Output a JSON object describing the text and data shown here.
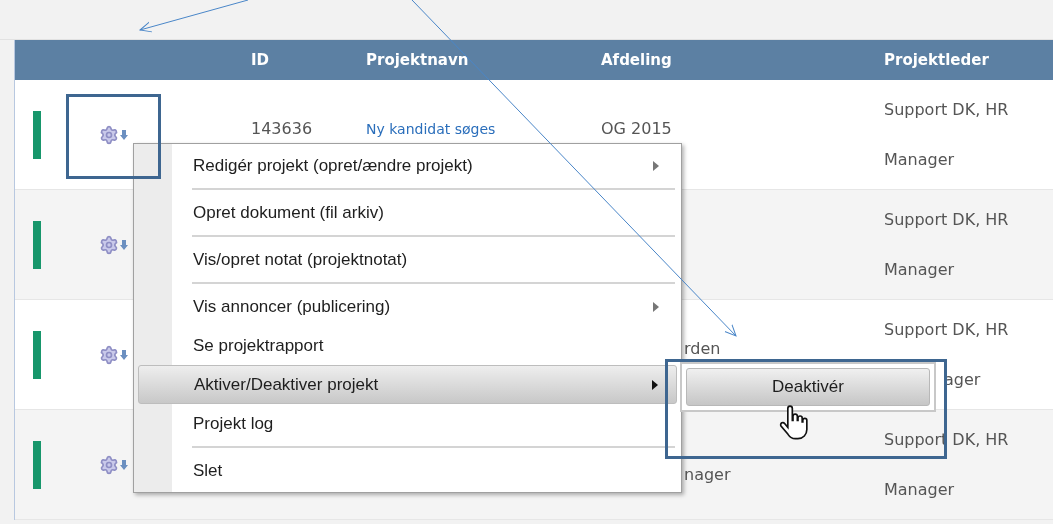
{
  "table": {
    "columns": [
      "ID",
      "Projektnavn",
      "Afdeling",
      "Projektleder"
    ],
    "rows": [
      {
        "color": "#17966b",
        "id": "143636",
        "name": "Ny kandidat søges",
        "department": "OG 2015",
        "manager": [
          "Support DK, HR",
          "Manager"
        ]
      },
      {
        "color": "#17966b",
        "manager": [
          "Support DK, HR",
          "Manager"
        ]
      },
      {
        "color": "#17966b",
        "department": "rden",
        "manager": [
          "Support DK, HR",
          "ager"
        ]
      },
      {
        "color": "#17966b",
        "department": "nager",
        "manager": [
          "Support DK, HR",
          "Manager"
        ]
      }
    ]
  },
  "context_menu": {
    "items": [
      {
        "label": "Redigér projekt (opret/ændre projekt)",
        "has_submenu": true,
        "selected": false,
        "separator_after": true
      },
      {
        "label": "Opret dokument (fil arkiv)",
        "has_submenu": false,
        "selected": false,
        "separator_after": true
      },
      {
        "label": "Vis/opret notat (projektnotat)",
        "has_submenu": false,
        "selected": false,
        "separator_after": true
      },
      {
        "label": "Vis annoncer (publicering)",
        "has_submenu": true,
        "selected": false,
        "separator_after": false
      },
      {
        "label": "Se projektrapport",
        "has_submenu": false,
        "selected": false,
        "separator_after": false
      },
      {
        "label": "Aktiver/Deaktiver projekt",
        "has_submenu": true,
        "selected": true,
        "separator_after": false
      },
      {
        "label": "Projekt log",
        "has_submenu": false,
        "selected": false,
        "separator_after": true
      },
      {
        "label": "Slet",
        "has_submenu": false,
        "selected": false,
        "separator_after": false
      }
    ]
  },
  "submenu": {
    "items": [
      {
        "label": "Deaktivér",
        "selected": true
      }
    ]
  }
}
